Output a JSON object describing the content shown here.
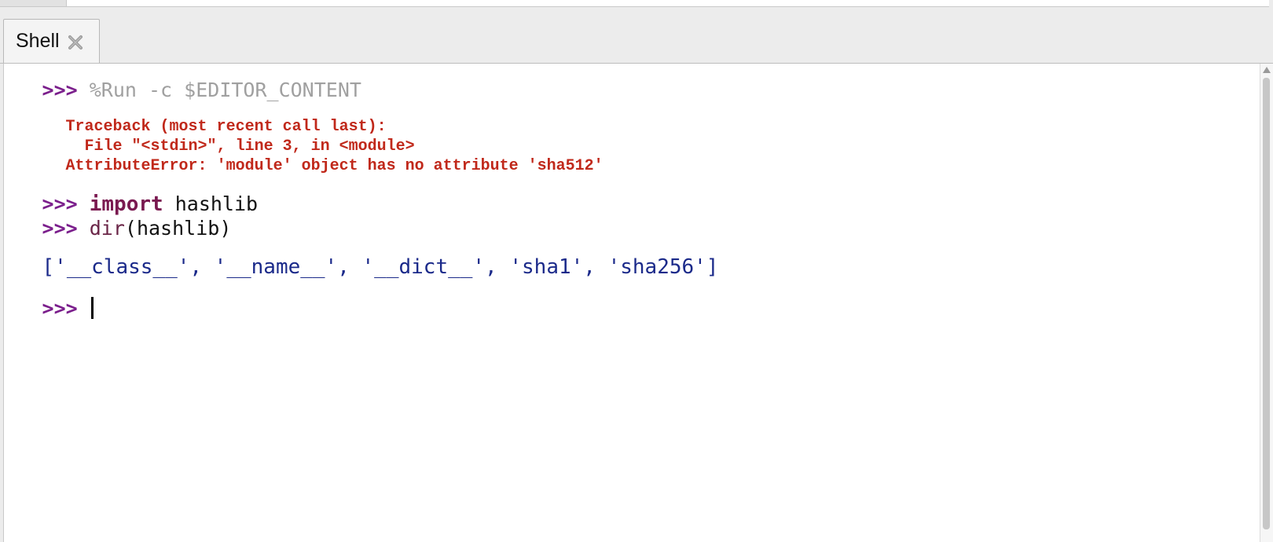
{
  "tabs": [
    {
      "label": "Shell",
      "close_icon": "close-icon"
    }
  ],
  "shell": {
    "prompt": ">>>",
    "lines": {
      "run_command": "%Run -c $EDITOR_CONTENT",
      "traceback_header": "Traceback (most recent call last):",
      "traceback_file": "  File \"<stdin>\", line 3, in <module>",
      "traceback_error": "AttributeError: 'module' object has no attribute 'sha512'",
      "import_keyword": "import",
      "import_module": " hashlib",
      "dir_func": "dir",
      "dir_args": "(hashlib)",
      "dir_output": "['__class__', '__name__', '__dict__', 'sha1', 'sha256']"
    }
  },
  "colors": {
    "prompt": "#7b1f8c",
    "error": "#c0281a",
    "keyword": "#7a1950",
    "output": "#1b2a8a",
    "magic_command": "#a0a0a0"
  }
}
